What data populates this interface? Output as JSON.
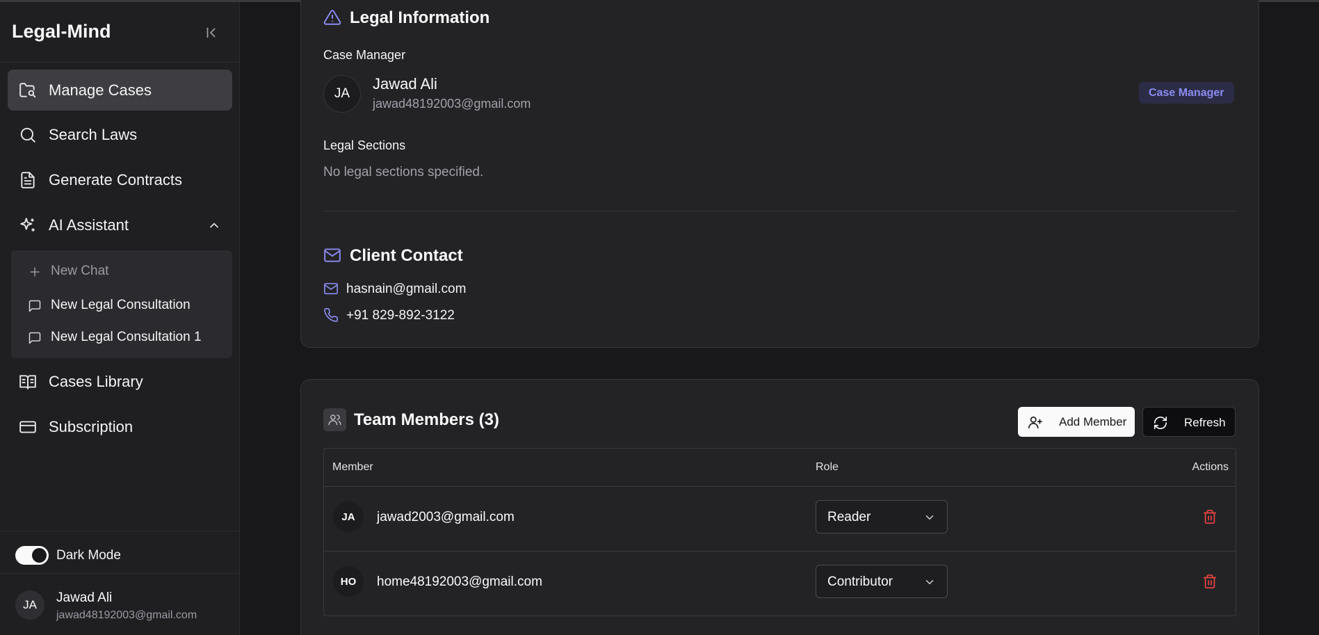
{
  "sidebar": {
    "brand": "Legal-Mind",
    "nav": [
      {
        "label": "Manage Cases",
        "icon": "folder-search-icon",
        "active": true
      },
      {
        "label": "Search Laws",
        "icon": "search-icon"
      },
      {
        "label": "Generate Contracts",
        "icon": "file-text-icon"
      },
      {
        "label": "AI Assistant",
        "icon": "sparkles-icon",
        "expanded": true
      },
      {
        "label": "Cases Library",
        "icon": "book-open-icon"
      },
      {
        "label": "Subscription",
        "icon": "credit-card-icon"
      }
    ],
    "ai_submenu": [
      {
        "label": "New Chat",
        "icon": "plus-icon"
      },
      {
        "label": "New Legal Consultation",
        "icon": "message-square-icon"
      },
      {
        "label": "New Legal Consultation 1",
        "icon": "message-square-icon"
      }
    ],
    "dark_mode_label": "Dark Mode",
    "dark_mode_on": true,
    "user": {
      "initials": "JA",
      "name": "Jawad Ali",
      "email": "jawad48192003@gmail.com"
    }
  },
  "legal_info": {
    "title": "Legal Information",
    "case_manager_label": "Case Manager",
    "manager": {
      "initials": "JA",
      "name": "Jawad Ali",
      "email": "jawad48192003@gmail.com",
      "badge": "Case Manager"
    },
    "sections_label": "Legal Sections",
    "sections_empty": "No legal sections specified."
  },
  "client_contact": {
    "title": "Client Contact",
    "email": "hasnain@gmail.com",
    "phone": "+91 829-892-3122"
  },
  "team": {
    "title": "Team Members (3)",
    "add_button": "Add Member",
    "refresh_button": "Refresh",
    "columns": {
      "member": "Member",
      "role": "Role",
      "actions": "Actions"
    },
    "members": [
      {
        "initials": "JA",
        "email": "jawad2003@gmail.com",
        "role": "Reader"
      },
      {
        "initials": "HO",
        "email": "home48192003@gmail.com",
        "role": "Contributor"
      }
    ]
  },
  "colors": {
    "accent": "#8b8cf0",
    "danger": "#ef4444",
    "background": "#18181b"
  }
}
